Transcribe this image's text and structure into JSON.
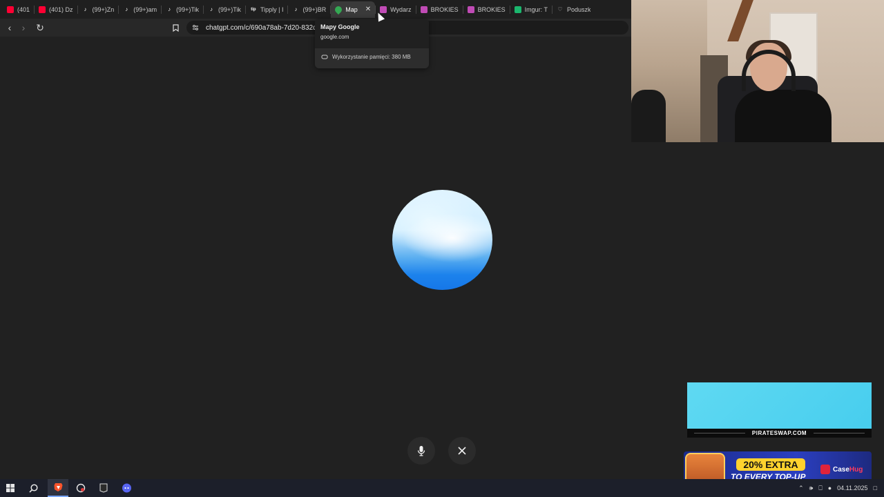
{
  "browser": {
    "tabs": [
      {
        "label": "(401",
        "icon": "youtube-icon",
        "color": "#ff0033"
      },
      {
        "label": "(401) Dz",
        "icon": "youtube-icon",
        "color": "#ff0033"
      },
      {
        "label": "(99+)Zn",
        "icon": "tiktok-icon",
        "color": "#ffffff"
      },
      {
        "label": "(99+)am",
        "icon": "tiktok-icon",
        "color": "#ffffff"
      },
      {
        "label": "(99+)Tik",
        "icon": "tiktok-icon",
        "color": "#ffffff"
      },
      {
        "label": "(99+)Tik",
        "icon": "tiktok-icon",
        "color": "#ffffff"
      },
      {
        "label": "Tipply | I",
        "icon": "tipply-icon",
        "color": "#ffffff"
      },
      {
        "label": "(99+)BR",
        "icon": "tiktok-icon",
        "color": "#ffffff"
      },
      {
        "label": "Map",
        "icon": "google-maps-icon",
        "color": "#34a853",
        "active": true
      },
      {
        "label": "Wydarz",
        "icon": "brokies-icon",
        "color": "#c04bb5"
      },
      {
        "label": "BROKIES",
        "icon": "brokies-icon",
        "color": "#c04bb5"
      },
      {
        "label": "BROKIES",
        "icon": "brokies-icon",
        "color": "#c04bb5"
      },
      {
        "label": "Imgur: T",
        "icon": "imgur-icon",
        "color": "#1bb76e"
      },
      {
        "label": "Poduszk",
        "icon": "heart-icon",
        "color": "#bbbbbb"
      }
    ],
    "address": "chatgpt.com/c/690a78ab-7d20-832d-9"
  },
  "tooltip": {
    "title": "Mapy Google",
    "url": "google.com",
    "memory": "Wykorzystanie pamięci: 380 MB"
  },
  "ads": {
    "pirateswap": "PIRATESWAP.COM",
    "casehug_offer": "20% EXTRA",
    "casehug_tagline": "TO EVERY TOP-UP",
    "casehug_brand_a": "Case",
    "casehug_brand_b": "Hug",
    "casehug_brand_b_color": "#ff3b5c"
  },
  "taskbar": {
    "date": "04.11.2025"
  }
}
